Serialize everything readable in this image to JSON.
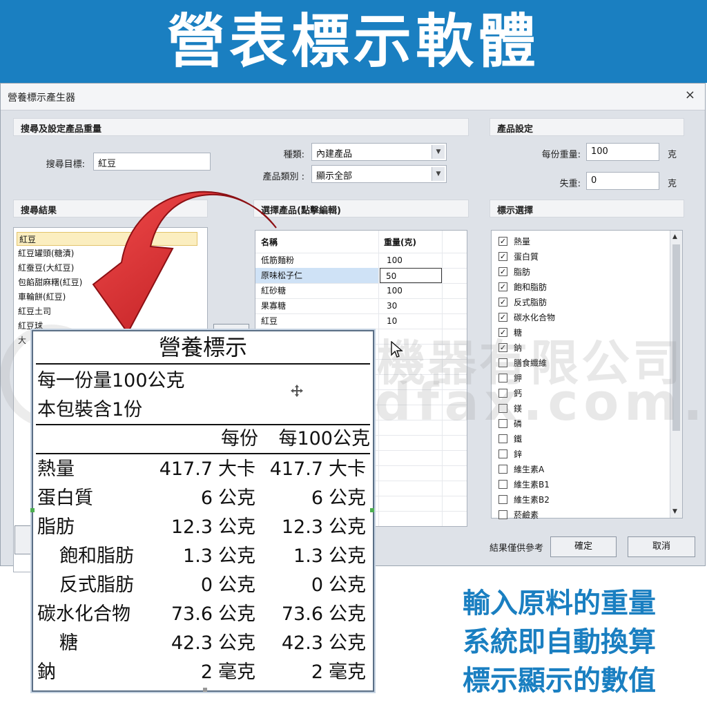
{
  "banner": {
    "title": "營表標示軟體"
  },
  "window": {
    "title": "營養標示產生器",
    "close_glyph": "×"
  },
  "search_section": {
    "header": "搜尋及設定產品重量",
    "target_label": "搜尋目標:",
    "target_value": "紅豆",
    "kind_label": "種類:",
    "kind_value": "內建產品",
    "category_label": "產品類別 :",
    "category_value": "顯示全部"
  },
  "results_section": {
    "header": "搜尋結果",
    "items": [
      "紅豆",
      "紅豆罐頭(糖漬)",
      "紅蚕豆(大紅豆)",
      "包餡甜麻糬(紅豆)",
      "車輪餅(紅豆)",
      "紅豆土司",
      "紅豆球",
      "大"
    ]
  },
  "selected_section": {
    "header": "選擇產品(點擊編輯)",
    "col_name": "名稱",
    "col_weight": "重量(克)",
    "rows": [
      {
        "name": "低筋麵粉",
        "weight": "100"
      },
      {
        "name": "原味松子仁",
        "weight": "50"
      },
      {
        "name": "紅砂糖",
        "weight": "100"
      },
      {
        "name": "果寡糖",
        "weight": "30"
      },
      {
        "name": "紅豆",
        "weight": "10"
      }
    ]
  },
  "product_settings": {
    "header": "產品設定",
    "serving_label": "每份重量:",
    "serving_value": "100",
    "serving_unit": "克",
    "loss_label": "失重:",
    "loss_value": "0",
    "loss_unit": "克"
  },
  "label_options": {
    "header": "標示選擇",
    "items": [
      {
        "label": "熱量",
        "checked": "✓"
      },
      {
        "label": "蛋白質",
        "checked": "✓"
      },
      {
        "label": "脂肪",
        "checked": "✓"
      },
      {
        "label": "飽和脂肪",
        "checked": "✓"
      },
      {
        "label": "反式脂肪",
        "checked": "✓"
      },
      {
        "label": "碳水化合物",
        "checked": "✓"
      },
      {
        "label": "糖",
        "checked": "✓"
      },
      {
        "label": "鈉",
        "checked": "✓"
      },
      {
        "label": "膳食纖維",
        "checked": ""
      },
      {
        "label": "鉀",
        "checked": ""
      },
      {
        "label": "鈣",
        "checked": ""
      },
      {
        "label": "鎂",
        "checked": ""
      },
      {
        "label": "磷",
        "checked": ""
      },
      {
        "label": "鐵",
        "checked": ""
      },
      {
        "label": "鋅",
        "checked": ""
      },
      {
        "label": "維生素A",
        "checked": ""
      },
      {
        "label": "維生素B1",
        "checked": ""
      },
      {
        "label": "維生素B2",
        "checked": ""
      },
      {
        "label": "菸鹼素",
        "checked": ""
      }
    ]
  },
  "footer": {
    "note": "結果僅供參考",
    "ok": "確定",
    "cancel": "取消"
  },
  "watermark": {
    "line1": "騰友商業機器有限公司",
    "line2": "www.sdfax.com.tw"
  },
  "nutrition_panel": {
    "title": "營養標示",
    "serving_size": "每一份量100公克",
    "servings": "本包裝含1份",
    "col_per_serving": "每份",
    "col_per_100": "每100公克",
    "rows": [
      {
        "label": "熱量",
        "indent": false,
        "v1": "417.7",
        "u1": "大卡",
        "v2": "417.7",
        "u2": "大卡"
      },
      {
        "label": "蛋白質",
        "indent": false,
        "v1": "6",
        "u1": "公克",
        "v2": "6",
        "u2": "公克"
      },
      {
        "label": "脂肪",
        "indent": false,
        "v1": "12.3",
        "u1": "公克",
        "v2": "12.3",
        "u2": "公克"
      },
      {
        "label": "飽和脂肪",
        "indent": true,
        "v1": "1.3",
        "u1": "公克",
        "v2": "1.3",
        "u2": "公克"
      },
      {
        "label": "反式脂肪",
        "indent": true,
        "v1": "0",
        "u1": "公克",
        "v2": "0",
        "u2": "公克"
      },
      {
        "label": "碳水化合物",
        "indent": false,
        "v1": "73.6",
        "u1": "公克",
        "v2": "73.6",
        "u2": "公克"
      },
      {
        "label": "糖",
        "indent": true,
        "v1": "42.3",
        "u1": "公克",
        "v2": "42.3",
        "u2": "公克"
      },
      {
        "label": "鈉",
        "indent": false,
        "v1": "2",
        "u1": "毫克",
        "v2": "2",
        "u2": "毫克"
      }
    ]
  },
  "caption": {
    "line1": "輸入原料的重量",
    "line2": "系統即自動換算",
    "line3": "標示顯示的數值"
  },
  "colors": {
    "banner": "#1a7fc1",
    "arrow": "#d8262a",
    "caption": "#1a7fc1"
  }
}
